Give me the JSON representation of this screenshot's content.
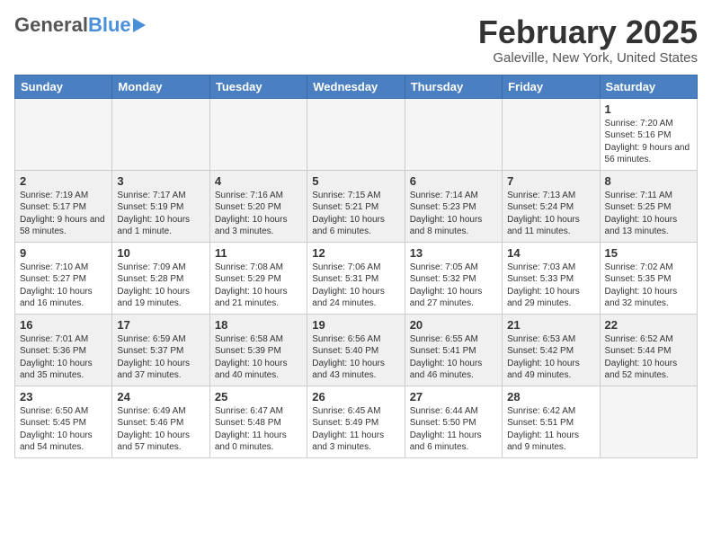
{
  "header": {
    "logo_general": "General",
    "logo_blue": "Blue",
    "month_year": "February 2025",
    "location": "Galeville, New York, United States"
  },
  "days_of_week": [
    "Sunday",
    "Monday",
    "Tuesday",
    "Wednesday",
    "Thursday",
    "Friday",
    "Saturday"
  ],
  "weeks": [
    [
      {
        "num": "",
        "info": ""
      },
      {
        "num": "",
        "info": ""
      },
      {
        "num": "",
        "info": ""
      },
      {
        "num": "",
        "info": ""
      },
      {
        "num": "",
        "info": ""
      },
      {
        "num": "",
        "info": ""
      },
      {
        "num": "1",
        "info": "Sunrise: 7:20 AM\nSunset: 5:16 PM\nDaylight: 9 hours and 56 minutes."
      }
    ],
    [
      {
        "num": "2",
        "info": "Sunrise: 7:19 AM\nSunset: 5:17 PM\nDaylight: 9 hours and 58 minutes."
      },
      {
        "num": "3",
        "info": "Sunrise: 7:17 AM\nSunset: 5:19 PM\nDaylight: 10 hours and 1 minute."
      },
      {
        "num": "4",
        "info": "Sunrise: 7:16 AM\nSunset: 5:20 PM\nDaylight: 10 hours and 3 minutes."
      },
      {
        "num": "5",
        "info": "Sunrise: 7:15 AM\nSunset: 5:21 PM\nDaylight: 10 hours and 6 minutes."
      },
      {
        "num": "6",
        "info": "Sunrise: 7:14 AM\nSunset: 5:23 PM\nDaylight: 10 hours and 8 minutes."
      },
      {
        "num": "7",
        "info": "Sunrise: 7:13 AM\nSunset: 5:24 PM\nDaylight: 10 hours and 11 minutes."
      },
      {
        "num": "8",
        "info": "Sunrise: 7:11 AM\nSunset: 5:25 PM\nDaylight: 10 hours and 13 minutes."
      }
    ],
    [
      {
        "num": "9",
        "info": "Sunrise: 7:10 AM\nSunset: 5:27 PM\nDaylight: 10 hours and 16 minutes."
      },
      {
        "num": "10",
        "info": "Sunrise: 7:09 AM\nSunset: 5:28 PM\nDaylight: 10 hours and 19 minutes."
      },
      {
        "num": "11",
        "info": "Sunrise: 7:08 AM\nSunset: 5:29 PM\nDaylight: 10 hours and 21 minutes."
      },
      {
        "num": "12",
        "info": "Sunrise: 7:06 AM\nSunset: 5:31 PM\nDaylight: 10 hours and 24 minutes."
      },
      {
        "num": "13",
        "info": "Sunrise: 7:05 AM\nSunset: 5:32 PM\nDaylight: 10 hours and 27 minutes."
      },
      {
        "num": "14",
        "info": "Sunrise: 7:03 AM\nSunset: 5:33 PM\nDaylight: 10 hours and 29 minutes."
      },
      {
        "num": "15",
        "info": "Sunrise: 7:02 AM\nSunset: 5:35 PM\nDaylight: 10 hours and 32 minutes."
      }
    ],
    [
      {
        "num": "16",
        "info": "Sunrise: 7:01 AM\nSunset: 5:36 PM\nDaylight: 10 hours and 35 minutes."
      },
      {
        "num": "17",
        "info": "Sunrise: 6:59 AM\nSunset: 5:37 PM\nDaylight: 10 hours and 37 minutes."
      },
      {
        "num": "18",
        "info": "Sunrise: 6:58 AM\nSunset: 5:39 PM\nDaylight: 10 hours and 40 minutes."
      },
      {
        "num": "19",
        "info": "Sunrise: 6:56 AM\nSunset: 5:40 PM\nDaylight: 10 hours and 43 minutes."
      },
      {
        "num": "20",
        "info": "Sunrise: 6:55 AM\nSunset: 5:41 PM\nDaylight: 10 hours and 46 minutes."
      },
      {
        "num": "21",
        "info": "Sunrise: 6:53 AM\nSunset: 5:42 PM\nDaylight: 10 hours and 49 minutes."
      },
      {
        "num": "22",
        "info": "Sunrise: 6:52 AM\nSunset: 5:44 PM\nDaylight: 10 hours and 52 minutes."
      }
    ],
    [
      {
        "num": "23",
        "info": "Sunrise: 6:50 AM\nSunset: 5:45 PM\nDaylight: 10 hours and 54 minutes."
      },
      {
        "num": "24",
        "info": "Sunrise: 6:49 AM\nSunset: 5:46 PM\nDaylight: 10 hours and 57 minutes."
      },
      {
        "num": "25",
        "info": "Sunrise: 6:47 AM\nSunset: 5:48 PM\nDaylight: 11 hours and 0 minutes."
      },
      {
        "num": "26",
        "info": "Sunrise: 6:45 AM\nSunset: 5:49 PM\nDaylight: 11 hours and 3 minutes."
      },
      {
        "num": "27",
        "info": "Sunrise: 6:44 AM\nSunset: 5:50 PM\nDaylight: 11 hours and 6 minutes."
      },
      {
        "num": "28",
        "info": "Sunrise: 6:42 AM\nSunset: 5:51 PM\nDaylight: 11 hours and 9 minutes."
      },
      {
        "num": "",
        "info": ""
      }
    ]
  ]
}
